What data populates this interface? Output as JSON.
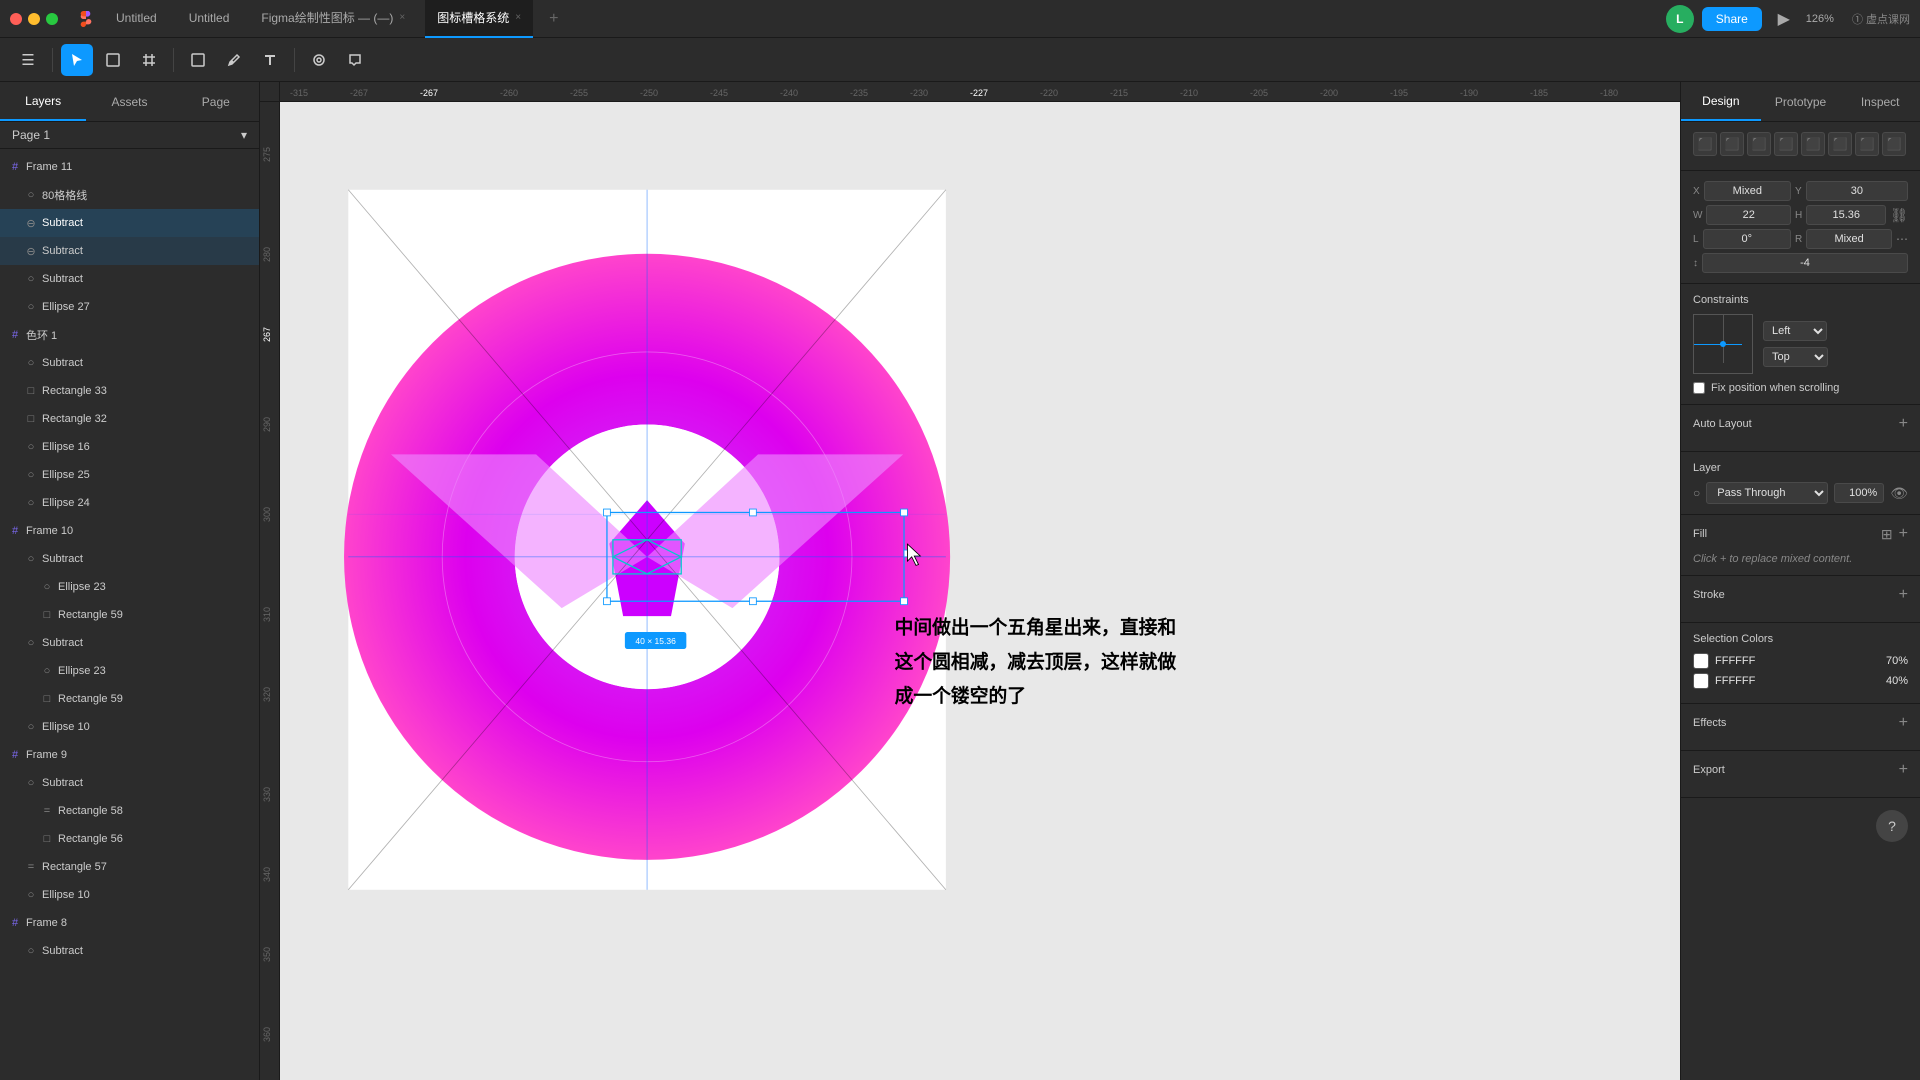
{
  "titlebar": {
    "tabs": [
      {
        "label": "Untitled",
        "active": false
      },
      {
        "label": "Untitled",
        "active": false
      },
      {
        "label": "Figma绘制性图标 — (—)",
        "active": false
      },
      {
        "label": "图标槽格系统",
        "active": true
      }
    ],
    "share_label": "Share",
    "zoom_level": "126%",
    "avatar_initials": "L"
  },
  "toolbar": {
    "tools": [
      {
        "name": "menu",
        "icon": "☰",
        "active": false
      },
      {
        "name": "move",
        "icon": "▶",
        "active": true
      },
      {
        "name": "scale",
        "icon": "⊞",
        "active": false
      },
      {
        "name": "frame",
        "icon": "⬜",
        "active": false
      },
      {
        "name": "shape",
        "icon": "◇",
        "active": false
      },
      {
        "name": "pen",
        "icon": "✒",
        "active": false
      },
      {
        "name": "text",
        "icon": "T",
        "active": false
      },
      {
        "name": "hand",
        "icon": "✋",
        "active": false
      },
      {
        "name": "comment",
        "icon": "💬",
        "active": false
      }
    ]
  },
  "left_panel": {
    "tabs": [
      "Layers",
      "Assets",
      "Page"
    ],
    "active_tab": "Layers",
    "page_name": "Page 1",
    "layers": [
      {
        "id": "frame11",
        "name": "Frame 11",
        "type": "frame",
        "indent": 0,
        "icon": "frame"
      },
      {
        "id": "80lines",
        "name": "80格格线",
        "type": "ellipse",
        "indent": 1,
        "icon": "ellipse"
      },
      {
        "id": "subtract1",
        "name": "Subtract",
        "type": "subtract",
        "indent": 1,
        "icon": "subtract",
        "selected": true
      },
      {
        "id": "subtract2",
        "name": "Subtract",
        "type": "subtract",
        "indent": 1,
        "icon": "subtract",
        "selected": true
      },
      {
        "id": "subtract3",
        "name": "Subtract",
        "type": "subtract",
        "indent": 1,
        "icon": "subtract"
      },
      {
        "id": "ellipse27",
        "name": "Ellipse 27",
        "type": "ellipse",
        "indent": 1,
        "icon": "ellipse"
      },
      {
        "id": "coloring1",
        "name": "色环 1",
        "type": "frame",
        "indent": 0,
        "icon": "frame"
      },
      {
        "id": "subtract4",
        "name": "Subtract",
        "type": "subtract",
        "indent": 1,
        "icon": "subtract"
      },
      {
        "id": "rect33",
        "name": "Rectangle 33",
        "type": "rect",
        "indent": 1,
        "icon": "rect"
      },
      {
        "id": "rect32",
        "name": "Rectangle 32",
        "type": "rect",
        "indent": 1,
        "icon": "rect"
      },
      {
        "id": "ellipse16",
        "name": "Ellipse 16",
        "type": "ellipse",
        "indent": 1,
        "icon": "ellipse"
      },
      {
        "id": "ellipse25",
        "name": "Ellipse 25",
        "type": "ellipse",
        "indent": 1,
        "icon": "ellipse"
      },
      {
        "id": "ellipse24",
        "name": "Ellipse 24",
        "type": "ellipse",
        "indent": 1,
        "icon": "ellipse"
      },
      {
        "id": "frame10",
        "name": "Frame 10",
        "type": "frame",
        "indent": 0,
        "icon": "frame"
      },
      {
        "id": "subtract5",
        "name": "Subtract",
        "type": "subtract",
        "indent": 1,
        "icon": "subtract"
      },
      {
        "id": "ellipse23a",
        "name": "Ellipse 23",
        "type": "ellipse",
        "indent": 2,
        "icon": "ellipse"
      },
      {
        "id": "rect59a",
        "name": "Rectangle 59",
        "type": "rect",
        "indent": 2,
        "icon": "rect"
      },
      {
        "id": "subtract6",
        "name": "Subtract",
        "type": "subtract",
        "indent": 1,
        "icon": "subtract"
      },
      {
        "id": "ellipse23b",
        "name": "Ellipse 23",
        "type": "ellipse",
        "indent": 2,
        "icon": "ellipse"
      },
      {
        "id": "rect59b",
        "name": "Rectangle 59",
        "type": "rect",
        "indent": 2,
        "icon": "rect"
      },
      {
        "id": "ellipse10a",
        "name": "Ellipse 10",
        "type": "ellipse",
        "indent": 1,
        "icon": "ellipse"
      },
      {
        "id": "frame9",
        "name": "Frame 9",
        "type": "frame",
        "indent": 0,
        "icon": "frame"
      },
      {
        "id": "subtract7",
        "name": "Subtract",
        "type": "subtract",
        "indent": 1,
        "icon": "subtract"
      },
      {
        "id": "rect58",
        "name": "Rectangle 58",
        "type": "rect",
        "indent": 2,
        "icon": "rect"
      },
      {
        "id": "rect56",
        "name": "Rectangle 56",
        "type": "rect",
        "indent": 2,
        "icon": "rect"
      },
      {
        "id": "rect57",
        "name": "Rectangle 57",
        "type": "rect",
        "indent": 1,
        "icon": "rect"
      },
      {
        "id": "ellipse10b",
        "name": "Ellipse 10",
        "type": "ellipse",
        "indent": 1,
        "icon": "ellipse"
      },
      {
        "id": "frame8",
        "name": "Frame 8",
        "type": "frame",
        "indent": 0,
        "icon": "frame"
      },
      {
        "id": "subtract8",
        "name": "Subtract",
        "type": "subtract",
        "indent": 1,
        "icon": "subtract"
      }
    ]
  },
  "canvas": {
    "ruler_labels": [
      "-315",
      "-267",
      "-260",
      "-255",
      "-250",
      "-245",
      "-240",
      "-235",
      "-230",
      "-227",
      "-220",
      "-215",
      "-210",
      "-205",
      "-200",
      "-195",
      "-190",
      "-185",
      "-180"
    ],
    "selection_tooltip": "40 × 15.36",
    "annotation": {
      "line1": "中间做出一个五角星出来，直接和",
      "line2": "这个圆相减，减去顶层，这样就做",
      "line3": "成一个镂空的了"
    }
  },
  "right_panel": {
    "tabs": [
      "Design",
      "Prototype",
      "Inspect"
    ],
    "active_tab": "Design",
    "position": {
      "x_label": "X",
      "y_label": "Y",
      "x_value": "Mixed",
      "y_value": "30",
      "w_label": "W",
      "h_label": "H",
      "w_value": "22",
      "h_value": "15.36",
      "rotation_label": "L",
      "rotation_value": "0°",
      "corner_label": "R",
      "corner_value": "Mixed",
      "constraint_label": "↕",
      "constraint_value": "-4"
    },
    "constraints": {
      "title": "Constraints",
      "left_label": "Left",
      "top_label": "Top",
      "fix_scroll_label": "Fix position when scrolling"
    },
    "auto_layout": {
      "title": "Auto Layout"
    },
    "layer": {
      "title": "Layer",
      "blend_mode": "Pass Through",
      "opacity": "100%"
    },
    "fill": {
      "title": "Fill",
      "placeholder": "Click + to replace mixed content."
    },
    "stroke": {
      "title": "Stroke"
    },
    "selection_colors": {
      "title": "Selection Colors",
      "colors": [
        {
          "hex": "FFFFFF",
          "opacity": "70%"
        },
        {
          "hex": "FFFFFF",
          "opacity": "40%"
        }
      ]
    },
    "effects": {
      "title": "Effects"
    },
    "export": {
      "title": "Export"
    }
  }
}
